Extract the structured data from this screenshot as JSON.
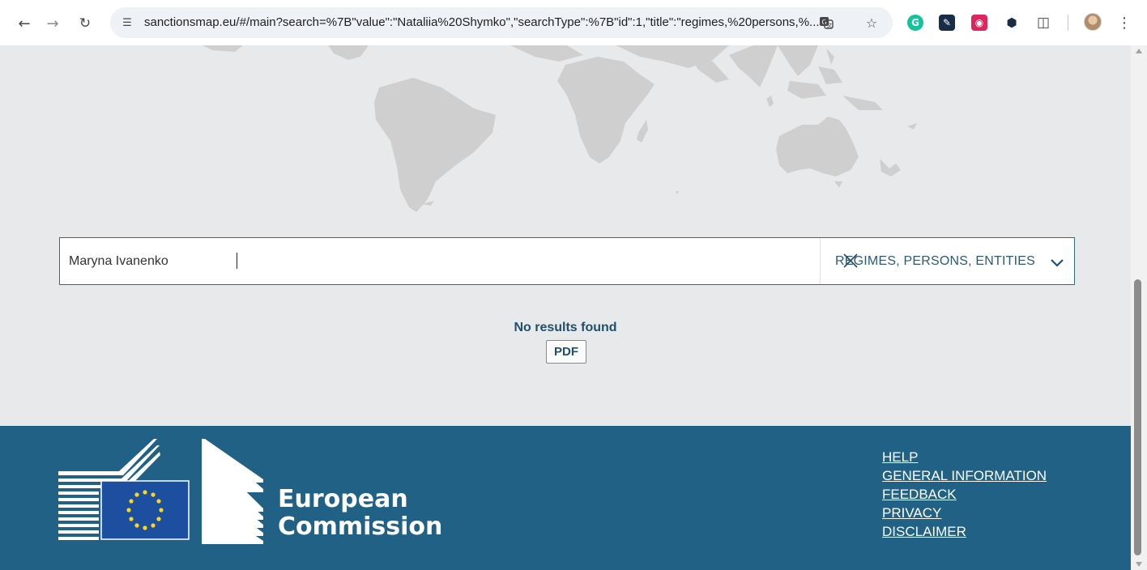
{
  "browser": {
    "url": "sanctionsmap.eu/#/main?search=%7B\"value\":\"Nataliia%20Shymko\",\"searchType\":%7B\"id\":1,\"title\":\"regimes,%20persons,%...",
    "icons": [
      "back-arrow-icon",
      "forward-arrow-icon",
      "reload-icon",
      "site-info-icon",
      "translate-icon",
      "bookmark-star-icon",
      "grammarly-icon",
      "extension-icon",
      "extension-icon",
      "extension-icon",
      "extensions-puzzle-icon",
      "profile-avatar",
      "menu-kebab-icon"
    ]
  },
  "search": {
    "value": "Maryna Ivanenko",
    "type_label": "REGIMES, PERSONS, ENTITIES"
  },
  "results": {
    "message": "No results found",
    "pdf_label": "PDF"
  },
  "footer": {
    "logo_line1": "European",
    "logo_line2": "Commission",
    "links": [
      "HELP",
      "GENERAL INFORMATION",
      "FEEDBACK",
      "PRIVACY",
      "DISCLAIMER"
    ]
  },
  "colors": {
    "footer_bg": "#216185",
    "page_bg": "#e8e9ea",
    "map_land": "#cfcfcf",
    "accent": "#2e6a8c",
    "eu_blue": "#1d4fa0",
    "eu_star": "#ffd617"
  }
}
